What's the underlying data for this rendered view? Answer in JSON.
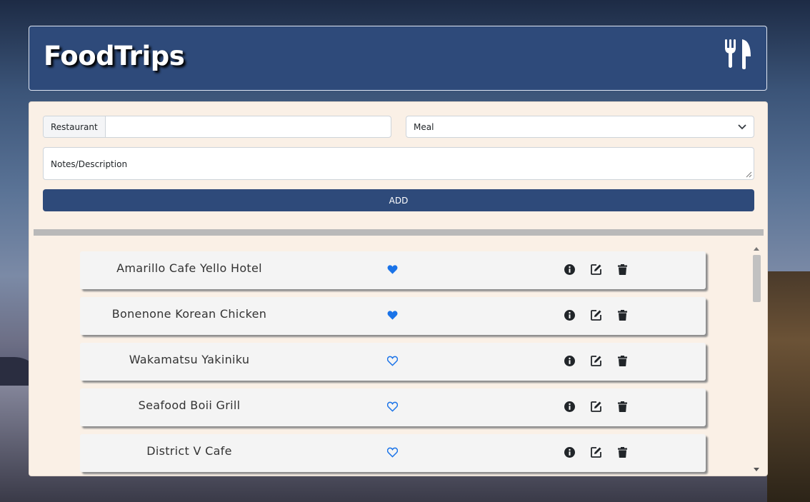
{
  "app": {
    "title": "FoodTrips",
    "logo_icon": "utensils-icon"
  },
  "form": {
    "restaurant_label": "Restaurant",
    "restaurant_value": "",
    "meal_selected": "Meal",
    "notes_placeholder": "Notes/Description",
    "add_label": "ADD"
  },
  "colors": {
    "primary": "#2e4a7a",
    "panel": "#faf0e6",
    "favorite": "#1a73e8",
    "card": "#f4f4f4"
  },
  "restaurants": [
    {
      "name": "Amarillo Cafe Yello Hotel",
      "favorite": true
    },
    {
      "name": "Bonenone Korean Chicken",
      "favorite": true
    },
    {
      "name": "Wakamatsu Yakiniku",
      "favorite": false
    },
    {
      "name": "Seafood Boii Grill",
      "favorite": false
    },
    {
      "name": "District V Cafe",
      "favorite": false
    }
  ],
  "row_actions": [
    "info-icon",
    "edit-icon",
    "trash-icon"
  ]
}
